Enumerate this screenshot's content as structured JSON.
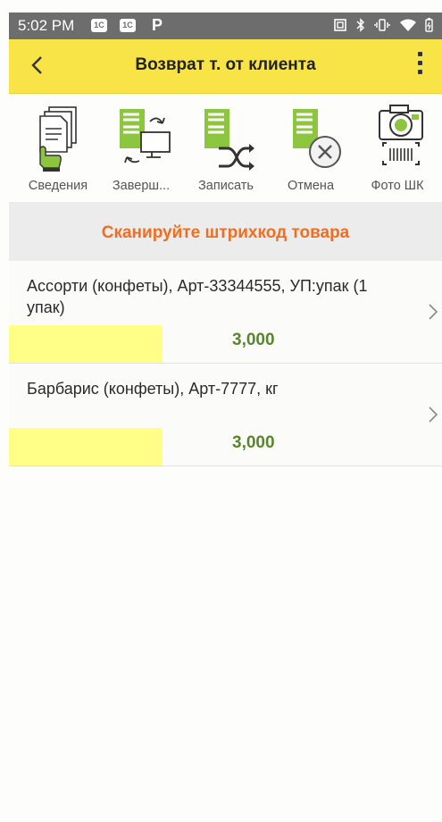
{
  "status_bar": {
    "time": "5:02 PM",
    "badge1": "1С",
    "badge2": "1С",
    "p_label": "P"
  },
  "app_bar": {
    "title": "Возврат т. от клиента"
  },
  "toolbar": {
    "items": [
      {
        "label": "Сведения",
        "icon": "document-hand-icon"
      },
      {
        "label": "Заверш...",
        "icon": "sync-monitor-icon"
      },
      {
        "label": "Записать",
        "icon": "shuffle-save-icon"
      },
      {
        "label": "Отмена",
        "icon": "cancel-icon"
      },
      {
        "label": "Фото ШК",
        "icon": "camera-barcode-icon"
      }
    ]
  },
  "banner": {
    "text": "Сканируйте штрихкод товара"
  },
  "items": [
    {
      "name": "Ассорти (конфеты), Арт-33344555, УП:упак (1 упак)",
      "qty": "3,000"
    },
    {
      "name": "Барбарис (конфеты), Арт-7777, кг",
      "qty": "3,000"
    }
  ],
  "colors": {
    "app_bar": "#f9e448",
    "banner_text": "#f06e21",
    "quantity": "#58862a",
    "highlight": "#ffff88",
    "icon_green": "#8cc63f"
  }
}
